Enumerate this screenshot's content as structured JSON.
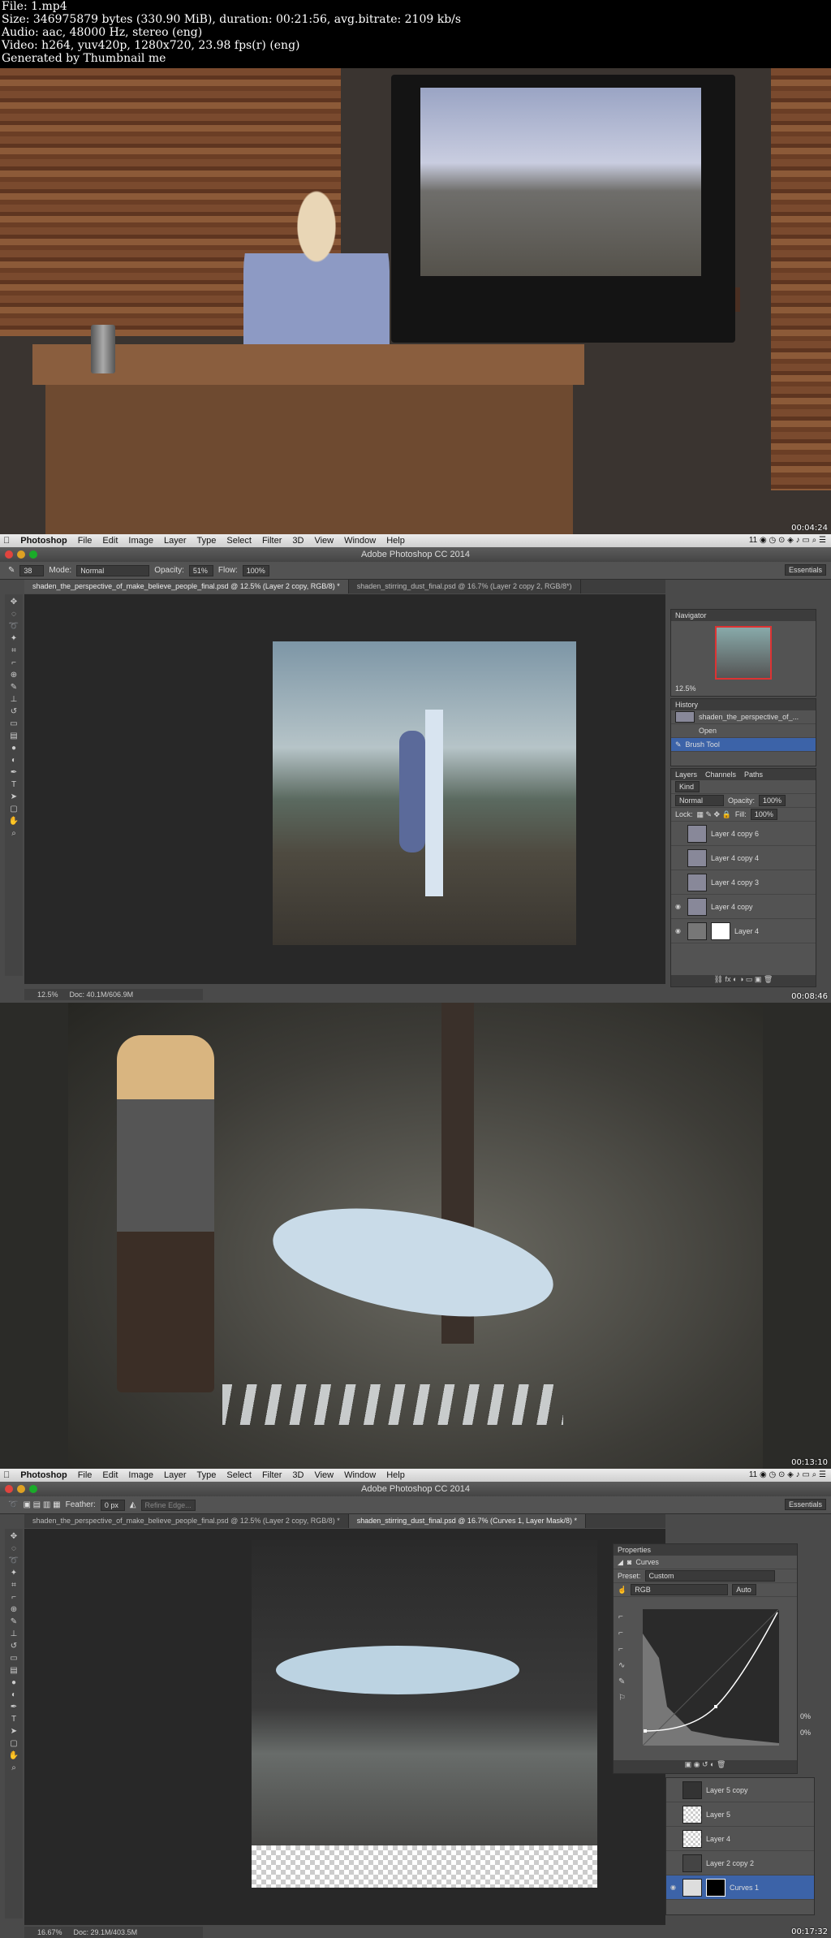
{
  "meta": {
    "line1": "File: 1.mp4",
    "line2": "Size: 346975879 bytes (330.90 MiB), duration: 00:21:56, avg.bitrate: 2109 kb/s",
    "line3": "Audio: aac, 48000 Hz, stereo (eng)",
    "line4": "Video: h264, yuv420p, 1280x720, 23.98 fps(r) (eng)",
    "line5": "Generated by Thumbnail me"
  },
  "frames": {
    "f1_time": "00:04:24",
    "f2_time": "00:08:46",
    "f3_time": "00:13:10",
    "f4_time": "00:17:32"
  },
  "menubar": {
    "app": "Photoshop",
    "items": [
      "File",
      "Edit",
      "Image",
      "Layer",
      "Type",
      "Select",
      "Filter",
      "3D",
      "View",
      "Window",
      "Help"
    ],
    "status_right": "11"
  },
  "title": "Adobe Photoshop CC 2014",
  "f2": {
    "brush_size": "38",
    "mode_label": "Mode:",
    "mode_value": "Normal",
    "opacity_label": "Opacity:",
    "opacity_value": "51%",
    "flow_label": "Flow:",
    "flow_value": "100%",
    "workspace": "Essentials",
    "tab1": "shaden_the_perspective_of_make_believe_people_final.psd @ 12.5% (Layer 2 copy, RGB/8) *",
    "tab2": "shaden_stirring_dust_final.psd @ 16.7% (Layer 2 copy 2, RGB/8*)",
    "zoom": "12.5%",
    "doc": "Doc: 40.1M/606.9M",
    "navigator": "Navigator",
    "nav_zoom": "12.5%",
    "history": "History",
    "history_items": [
      "shaden_the_perspective_of_...",
      "Open",
      "Brush Tool"
    ],
    "layers_tabs": [
      "Layers",
      "Channels",
      "Paths"
    ],
    "kind": "Kind",
    "blend": "Normal",
    "opacity_l": "Opacity:",
    "opacity_lv": "100%",
    "lock": "Lock:",
    "fill": "Fill:",
    "fill_v": "100%",
    "layers": [
      "Layer 4 copy 6",
      "Layer 4 copy 4",
      "Layer 4 copy 3",
      "Layer 4 copy",
      "Layer 4"
    ]
  },
  "f4": {
    "feather_label": "Feather:",
    "feather_value": "0 px",
    "refine": "Refine Edge...",
    "workspace": "Essentials",
    "tab1": "shaden_the_perspective_of_make_believe_people_final.psd @ 12.5% (Layer 2 copy, RGB/8) *",
    "tab2": "shaden_stirring_dust_final.psd @ 16.7% (Curves 1, Layer Mask/8) *",
    "zoom": "16.67%",
    "doc": "Doc: 29.1M/403.5M",
    "properties": "Properties",
    "curves": "Curves",
    "preset_label": "Preset:",
    "preset_value": "Custom",
    "channel": "RGB",
    "auto": "Auto",
    "layers": [
      "Layer 5 copy",
      "Layer 5",
      "Layer 4",
      "Layer 2 copy 2",
      "Curves 1"
    ],
    "pct1": "0%",
    "pct2": "0%"
  }
}
